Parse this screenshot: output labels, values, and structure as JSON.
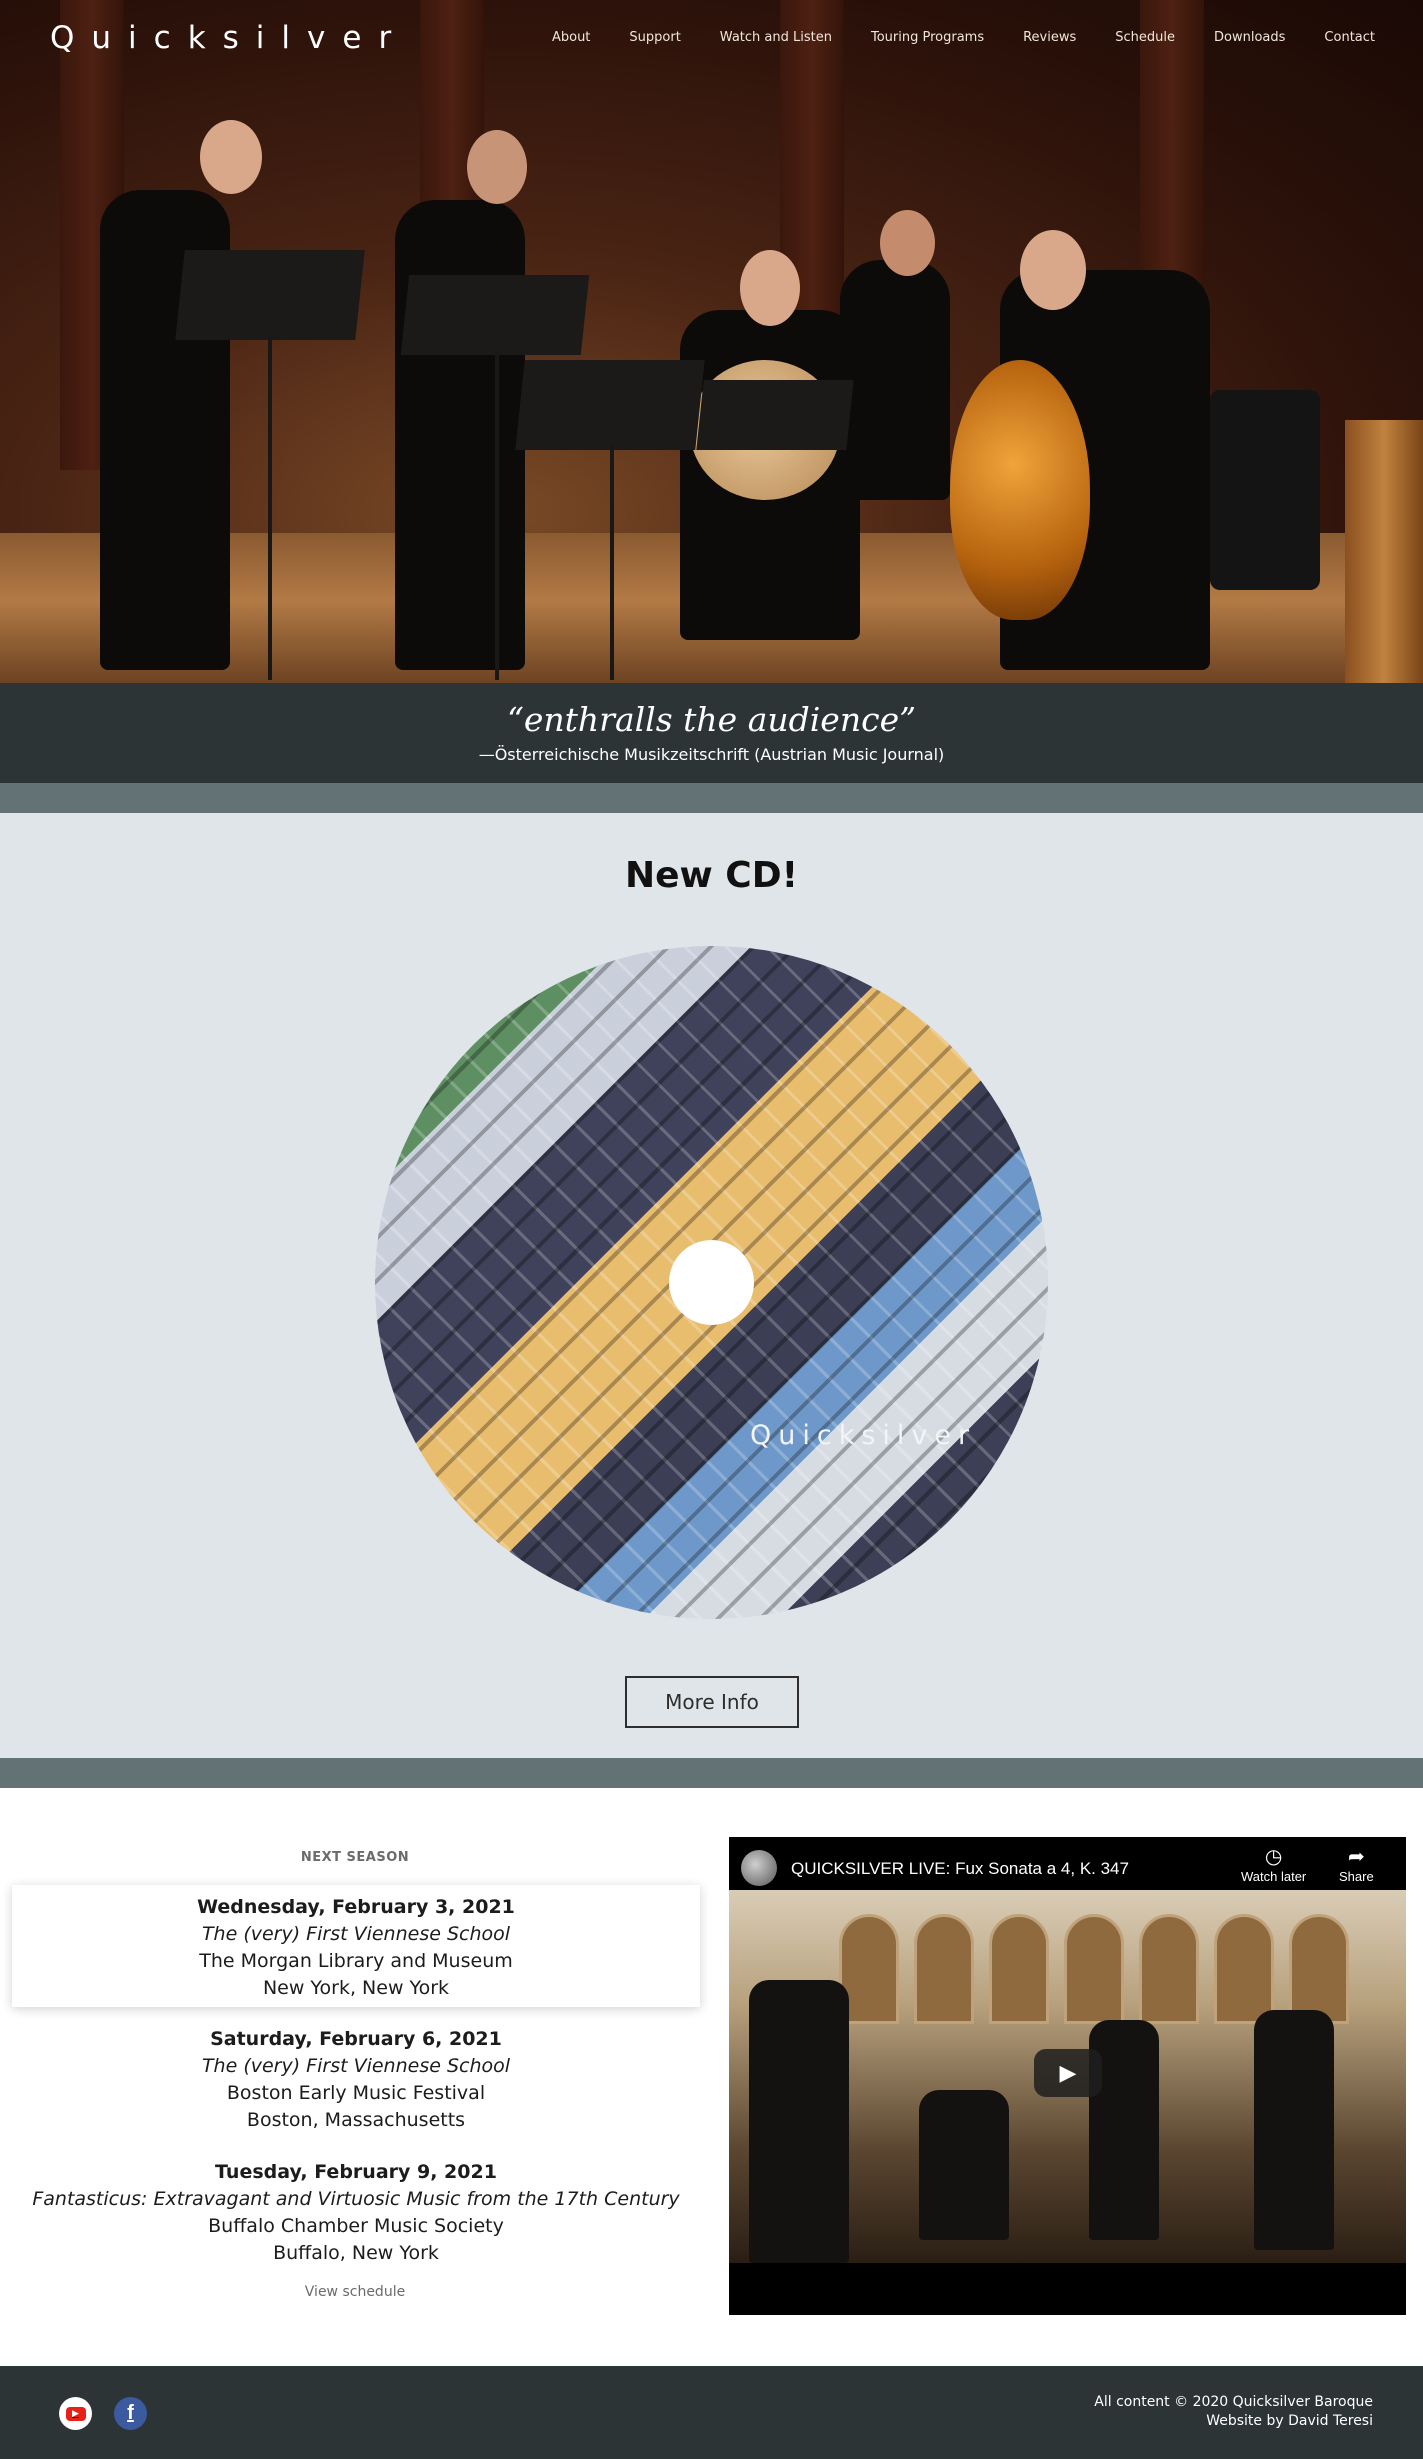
{
  "site": {
    "brand": "Quicksilver",
    "nav": [
      "About",
      "Support",
      "Watch and Listen",
      "Touring Programs",
      "Reviews",
      "Schedule",
      "Downloads",
      "Contact"
    ]
  },
  "hero": {
    "quote": "“enthralls the audience”",
    "source": "—Österreichische Musikzeitschrift (Austrian Music Journal)"
  },
  "cd": {
    "title": "New CD!",
    "disc_label": "Quicksilver",
    "button": "More Info"
  },
  "schedule": {
    "heading": "NEXT SEASON",
    "events": [
      {
        "date": "Wednesday, February 3, 2021",
        "program": "The (very) First Viennese School",
        "venue": "The Morgan Library and Museum",
        "city": "New York, New York"
      },
      {
        "date": "Saturday, February 6, 2021",
        "program": "The (very) First Viennese School",
        "venue": "Boston Early Music Festival",
        "city": "Boston, Massachusetts"
      },
      {
        "date": "Tuesday, February 9, 2021",
        "program": "Fantasticus: Extravagant and Virtuosic Music from the 17th Century",
        "venue": "Buffalo Chamber Music Society",
        "city": "Buffalo, New York"
      }
    ],
    "view_link": "View schedule"
  },
  "video": {
    "title": "QUICKSILVER LIVE: Fux Sonata a 4, K. 347",
    "watch_later": "Watch later",
    "share": "Share"
  },
  "footer": {
    "copyright": "All content © 2020 Quicksilver Baroque",
    "credit": "Website by David Teresi"
  },
  "colors": {
    "quote_band": "#2c3436",
    "separator": "#627275",
    "cd_background": "#dfe5e8",
    "footer": "#2c3436"
  }
}
